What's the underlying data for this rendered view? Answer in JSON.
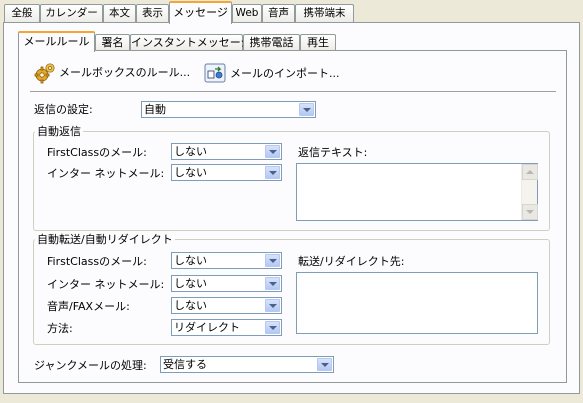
{
  "top_tabs": [
    "全般",
    "カレンダー",
    "本文",
    "表示",
    "メッセージ",
    "Web",
    "音声",
    "携帯端末"
  ],
  "top_active_tab": "メッセージ",
  "inner_tabs": [
    "メールルール",
    "署名",
    "インスタントメッセージ",
    "携帯電話",
    "再生"
  ],
  "inner_active_tab": "メールルール",
  "toolbar": {
    "mailbox_rules_label": "メールボックスのルール...",
    "import_rules_label": "メールのインポート..."
  },
  "reply_settings": {
    "label": "返信の設定:",
    "value": "自動"
  },
  "auto_reply": {
    "title": "自動返信",
    "firstclass_label": "FirstClassのメール:",
    "firstclass_value": "しない",
    "internet_label": "インター ネットメール:",
    "internet_value": "しない",
    "reply_text_label": "返信テキスト:"
  },
  "forward": {
    "title": "自動転送/自動リダイレクト",
    "firstclass_label": "FirstClassのメール:",
    "firstclass_value": "しない",
    "internet_label": "インター ネットメール:",
    "internet_value": "しない",
    "voice_fax_label": "音声/FAXメール:",
    "voice_fax_value": "しない",
    "method_label": "方法:",
    "method_value": "リダイレクト",
    "destination_label": "転送/リダイレクト先:"
  },
  "junk": {
    "label": "ジャンクメールの処理:",
    "value": "受信する"
  }
}
